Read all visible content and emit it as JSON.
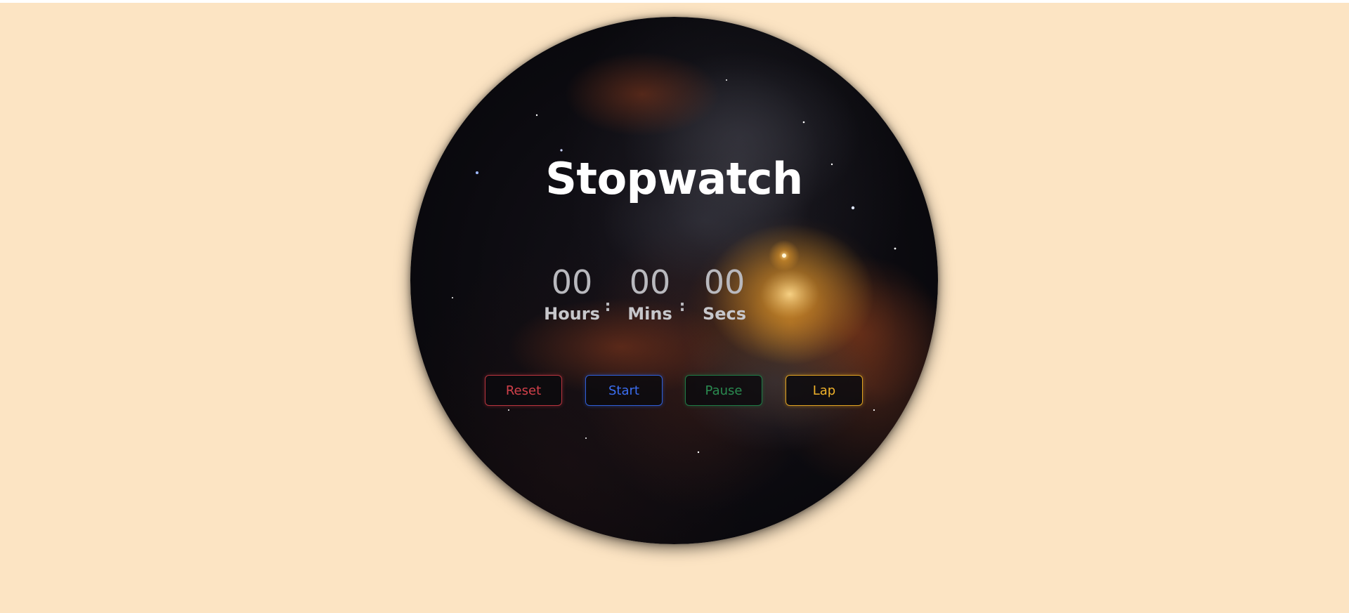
{
  "page": {
    "title": "Stopwatch"
  },
  "timer": {
    "hours": "00",
    "hours_label": "Hours",
    "minutes": "00",
    "minutes_label": "Mins",
    "seconds": "00",
    "seconds_label": "Secs",
    "separator": ":"
  },
  "controls": {
    "reset_label": "Reset",
    "start_label": "Start",
    "pause_label": "Pause",
    "lap_label": "Lap"
  },
  "colors": {
    "background": "#fce4c3",
    "reset": "#d1404a",
    "start": "#3b6df0",
    "pause": "#2a8a50",
    "lap": "#f0b22a"
  }
}
